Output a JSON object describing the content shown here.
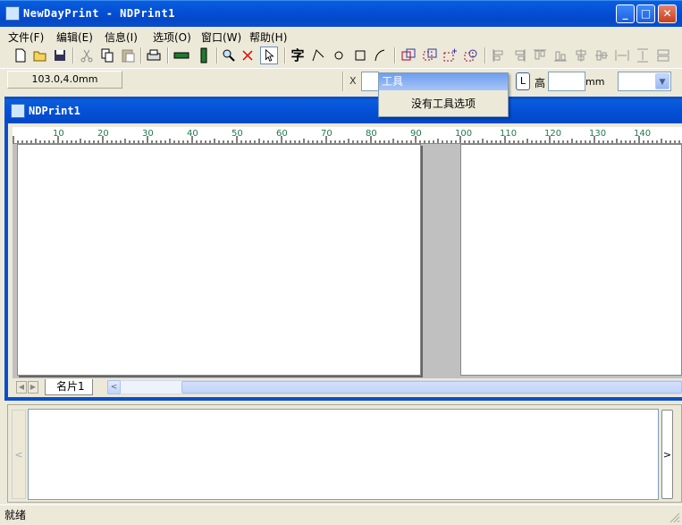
{
  "window": {
    "title": "NewDayPrint - NDPrint1",
    "min": "_",
    "max": "□",
    "close": "✕"
  },
  "menu": [
    "文件(F)",
    "编辑(E)",
    "信息(I)",
    "选项(O)",
    "窗口(W)",
    "帮助(H)"
  ],
  "toolbar": {
    "text_tool_label": "字"
  },
  "propbar": {
    "coords": "103.0,4.0mm",
    "x_label": "X",
    "lock_label": "L",
    "height_label": "高",
    "unit": "mm",
    "combo_arrow": "▼"
  },
  "doc": {
    "title": "NDPrint1",
    "ruler_ticks": [
      "10",
      "20",
      "30",
      "40",
      "50",
      "60",
      "70",
      "80",
      "90",
      "100",
      "110",
      "120",
      "130",
      "140"
    ],
    "sheet_tab": "名片1",
    "scroll_left": "<"
  },
  "log": {
    "left_arrow": "<",
    "right_arrow": ">"
  },
  "status": {
    "text": "就绪"
  },
  "popup": {
    "title": "工具",
    "item": "没有工具选项"
  },
  "colors": {
    "titlebar": "#0550d6",
    "face": "#ece9d8",
    "canvas_gray": "#c0c0c0"
  }
}
